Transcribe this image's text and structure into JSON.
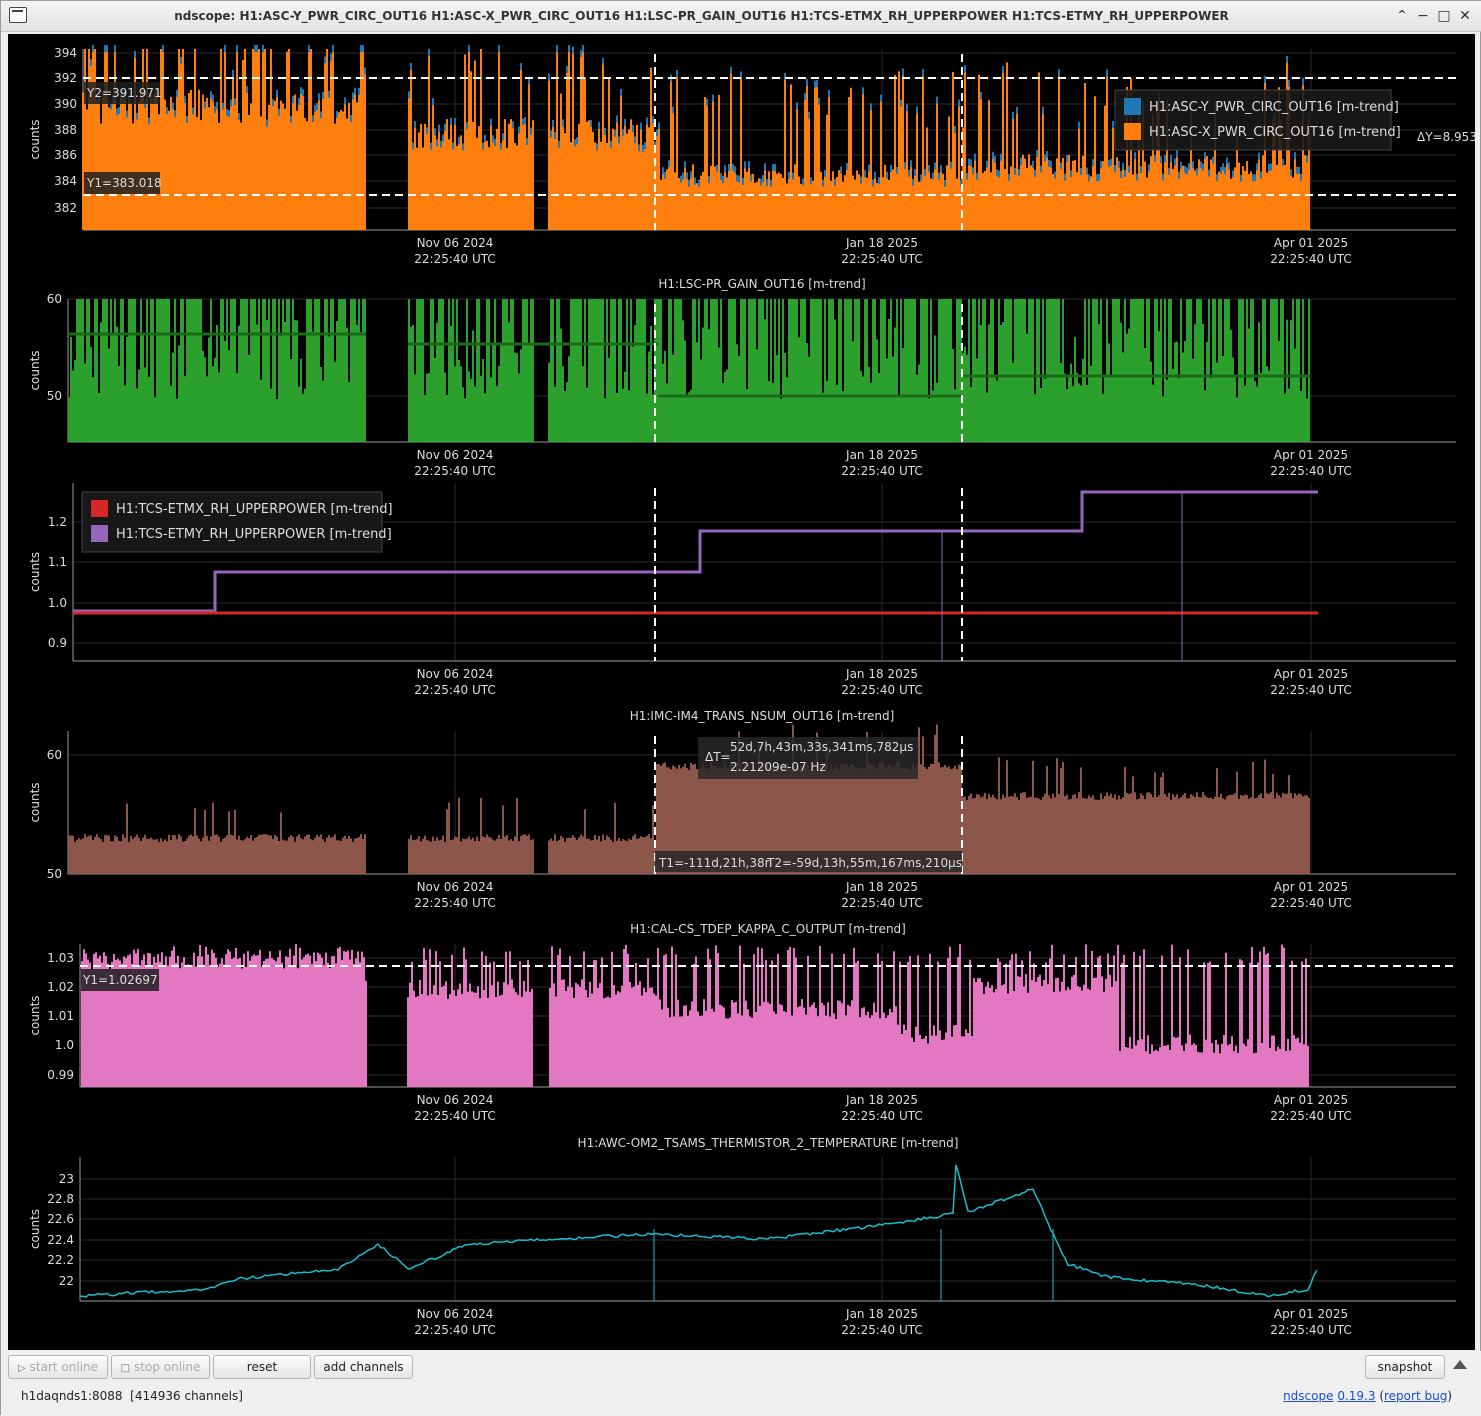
{
  "window": {
    "title": "ndscope: H1:ASC-Y_PWR_CIRC_OUT16 H1:ASC-X_PWR_CIRC_OUT16 H1:LSC-PR_GAIN_OUT16 H1:TCS-ETMX_RH_UPPERPOWER H1:TCS-ETMY_RH_UPPERPOWER"
  },
  "colors": {
    "background": "#000000",
    "grid": "#2a2a2a",
    "axis": "#9a9a9a",
    "text": "#dddddd",
    "cursor": "#ffffff"
  },
  "x_axis": {
    "ticks": [
      {
        "date": "Nov 06 2024",
        "time": "22:25:40 UTC"
      },
      {
        "date": "Jan 18 2025",
        "time": "22:25:40 UTC"
      },
      {
        "date": "Apr 01 2025",
        "time": "22:25:40 UTC"
      }
    ]
  },
  "plots": [
    {
      "title": "",
      "ylabel": "counts",
      "yticks": [
        "394",
        "392",
        "390",
        "388",
        "386",
        "384",
        "382"
      ],
      "legend": [
        {
          "name": "H1:ASC-Y_PWR_CIRC_OUT16 [m-trend]",
          "color": "#1f77b4"
        },
        {
          "name": "H1:ASC-X_PWR_CIRC_OUT16 [m-trend]",
          "color": "#ff7f0e"
        }
      ],
      "y_cursors": {
        "y1": "Y1=383.018",
        "y2": "Y2=391.971",
        "delta": "ΔY=8.9531"
      }
    },
    {
      "title": "H1:LSC-PR_GAIN_OUT16 [m-trend]",
      "ylabel": "counts",
      "yticks": [
        "60",
        "50"
      ],
      "color": "#2ca02c"
    },
    {
      "title": "",
      "ylabel": "counts",
      "yticks": [
        "1.2",
        "1.1",
        "1.0",
        "0.9"
      ],
      "legend": [
        {
          "name": "H1:TCS-ETMX_RH_UPPERPOWER [m-trend]",
          "color": "#d62728"
        },
        {
          "name": "H1:TCS-ETMY_RH_UPPERPOWER [m-trend]",
          "color": "#9467bd"
        }
      ]
    },
    {
      "title": "H1:IMC-IM4_TRANS_NSUM_OUT16 [m-trend]",
      "ylabel": "counts",
      "yticks": [
        "60",
        "50"
      ],
      "color": "#8c564b",
      "t_cursors": {
        "delta_label": "ΔT=",
        "delta": "52d,7h,43m,33s,341ms,782µs",
        "freq": "2.21209e-07 Hz",
        "t1": "T1=-111d,21h,38r",
        "t2": "T2=-59d,13h,55m,167ms,210µs"
      }
    },
    {
      "title": "H1:CAL-CS_TDEP_KAPPA_C_OUTPUT [m-trend]",
      "ylabel": "counts",
      "yticks": [
        "1.03",
        "1.02",
        "1.01",
        "1.0",
        "0.99"
      ],
      "color": "#e377c2",
      "y_cursors": {
        "y1": "Y1=1.02697"
      }
    },
    {
      "title": "H1:AWC-OM2_TSAMS_THERMISTOR_2_TEMPERATURE [m-trend]",
      "ylabel": "counts",
      "yticks": [
        "23",
        "22.8",
        "22.6",
        "22.4",
        "22.2",
        "22"
      ],
      "color": "#17becf"
    }
  ],
  "toolbar": {
    "start_online": "start online",
    "stop_online": "stop online",
    "reset": "reset",
    "add_channels": "add channels",
    "snapshot": "snapshot"
  },
  "status": {
    "server": "h1daqnds1:8088",
    "channels": "[414936 channels]",
    "app_name": "ndscope",
    "version": "0.19.3",
    "report_bug": "report bug"
  }
}
